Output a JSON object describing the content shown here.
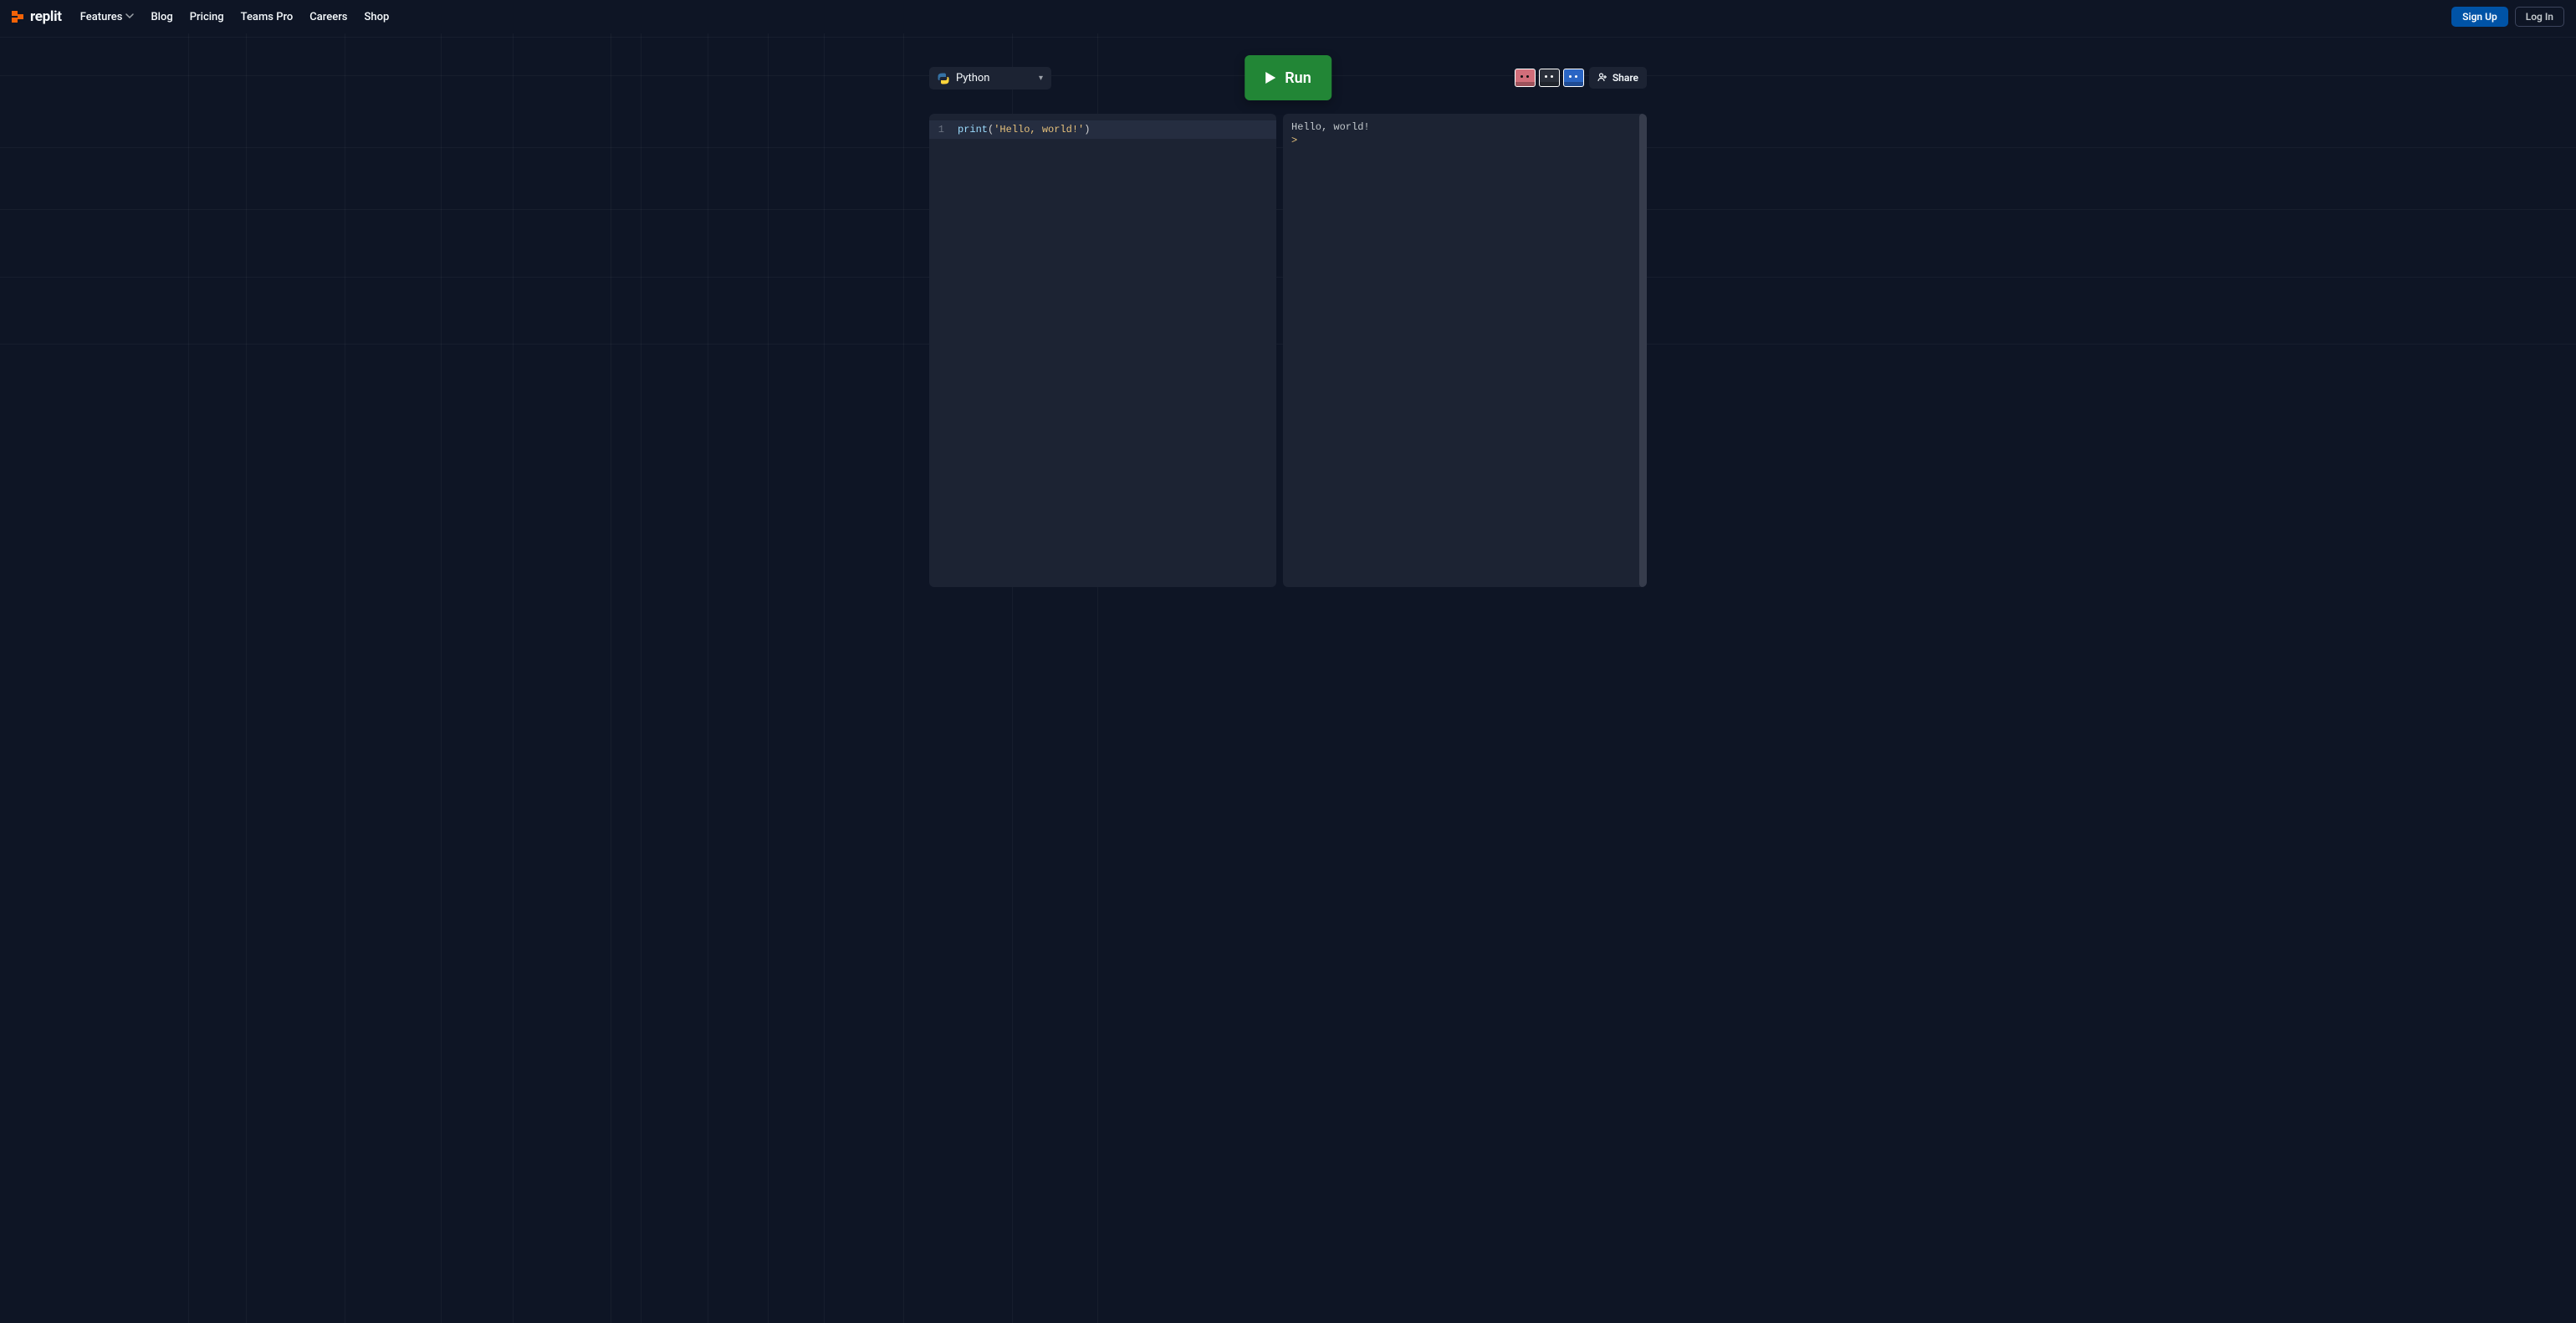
{
  "brand": {
    "name": "replit"
  },
  "nav": {
    "features": "Features",
    "blog": "Blog",
    "pricing": "Pricing",
    "teams_pro": "Teams Pro",
    "careers": "Careers",
    "shop": "Shop"
  },
  "auth": {
    "signup": "Sign Up",
    "login": "Log In"
  },
  "toolbar": {
    "language": "Python",
    "run": "Run",
    "share": "Share"
  },
  "editor": {
    "line_number": "1",
    "code_fn": "print",
    "code_open": "(",
    "code_str": "'Hello, world!'",
    "code_close": ")"
  },
  "console": {
    "output": "Hello, world!",
    "prompt": ">"
  }
}
